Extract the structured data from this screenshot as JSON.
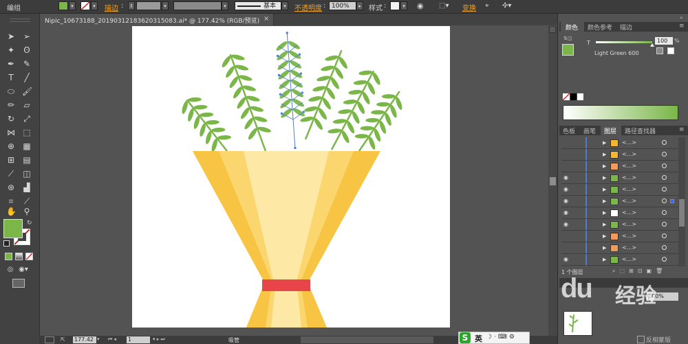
{
  "control_bar": {
    "selection_label": "编组",
    "stroke_label": "描边",
    "stroke_profile_label": "基本",
    "opacity_label": "不透明度",
    "opacity_value": "100%",
    "style_label": "样式",
    "transform_label": "变换",
    "fill_color": "#7ab648"
  },
  "document": {
    "tab_title": "Nipic_10673188_20190312183620315083.ai* @ 177.42% (RGB/预览)",
    "close_glyph": "×"
  },
  "status_bar": {
    "zoom": "177.42",
    "page": "1",
    "mode": "吸管"
  },
  "color_panel": {
    "tabs": [
      "颜色",
      "颜色参考",
      "描边"
    ],
    "tint_label": "T",
    "tint_value": "100",
    "tint_unit": "%",
    "swatch_name": "Light Green 600",
    "fill_color": "#7ab648",
    "gradient_end": "#7ab648"
  },
  "layers_panel": {
    "tabs": [
      "色板",
      "画笔",
      "图层",
      "路径查找器"
    ],
    "footer_count": "1 个图层",
    "rows": [
      {
        "eye": "",
        "thumb": "#f5b731",
        "name": "<...>",
        "selected": false
      },
      {
        "eye": "",
        "thumb": "#f5b731",
        "name": "<...>",
        "selected": false
      },
      {
        "eye": "",
        "thumb": "#f09a5b",
        "name": "<...>",
        "selected": false
      },
      {
        "eye": "◉",
        "thumb": "#7ab648",
        "name": "<...>",
        "selected": false
      },
      {
        "eye": "◉",
        "thumb": "#7ab648",
        "name": "<...>",
        "selected": false
      },
      {
        "eye": "◉",
        "thumb": "#7ab648",
        "name": "<...>",
        "selected": true
      },
      {
        "eye": "◉",
        "thumb": "#ffffff",
        "name": "<...>",
        "selected": false
      },
      {
        "eye": "◉",
        "thumb": "#7ab648",
        "name": "<...>",
        "selected": false
      },
      {
        "eye": "",
        "thumb": "#f09a5b",
        "name": "<...>",
        "selected": false
      },
      {
        "eye": "",
        "thumb": "#f09a5b",
        "name": "<...>",
        "selected": false
      },
      {
        "eye": "◉",
        "thumb": "#7ab648",
        "name": "<...>",
        "selected": false
      }
    ]
  },
  "lower_panel": {
    "label": "反相蒙版",
    "watermark": "经验"
  },
  "ime_bar": {
    "logo": "S",
    "lang": "英"
  },
  "colors": {
    "wrap_light": "#fde8a6",
    "wrap_mid": "#fbd66e",
    "wrap_dark": "#f7c444",
    "ribbon": "#e8454a",
    "leaf": "#7ab648",
    "path_blue": "#4f7ccc"
  }
}
